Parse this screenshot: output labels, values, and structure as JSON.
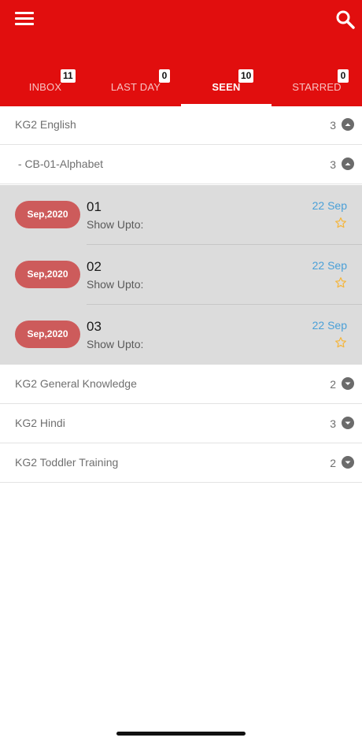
{
  "tabs": [
    {
      "label": "INBOX",
      "badge": "11"
    },
    {
      "label": "LAST DAY",
      "badge": "0"
    },
    {
      "label": "SEEN",
      "badge": "10"
    },
    {
      "label": "STARRED",
      "badge": "0"
    }
  ],
  "groups": [
    {
      "title": "KG2 English",
      "count": "3"
    },
    {
      "title": " - CB-01-Alphabet",
      "count": "3"
    },
    {
      "title": "KG2 General Knowledge",
      "count": "2"
    },
    {
      "title": "KG2 Hindi",
      "count": "3"
    },
    {
      "title": "KG2 Toddler Training",
      "count": "2"
    }
  ],
  "messages": [
    {
      "pill": "Sep,2020",
      "title": "01",
      "subtitle": "Show Upto:",
      "date": "22 Sep"
    },
    {
      "pill": "Sep,2020",
      "title": "02",
      "subtitle": "Show Upto:",
      "date": "22 Sep"
    },
    {
      "pill": "Sep,2020",
      "title": "03",
      "subtitle": "Show Upto:",
      "date": "22 Sep"
    }
  ],
  "icons": {
    "menu": "menu-icon",
    "search": "search-icon",
    "expand": "chevron-icon",
    "star": "star-outline-icon"
  },
  "colors": {
    "header": "#e10e0e",
    "pill": "#cd5b5b",
    "date": "#4aa0d8",
    "star": "#f5b53a",
    "expanded_bg": "#dcdcdc"
  }
}
